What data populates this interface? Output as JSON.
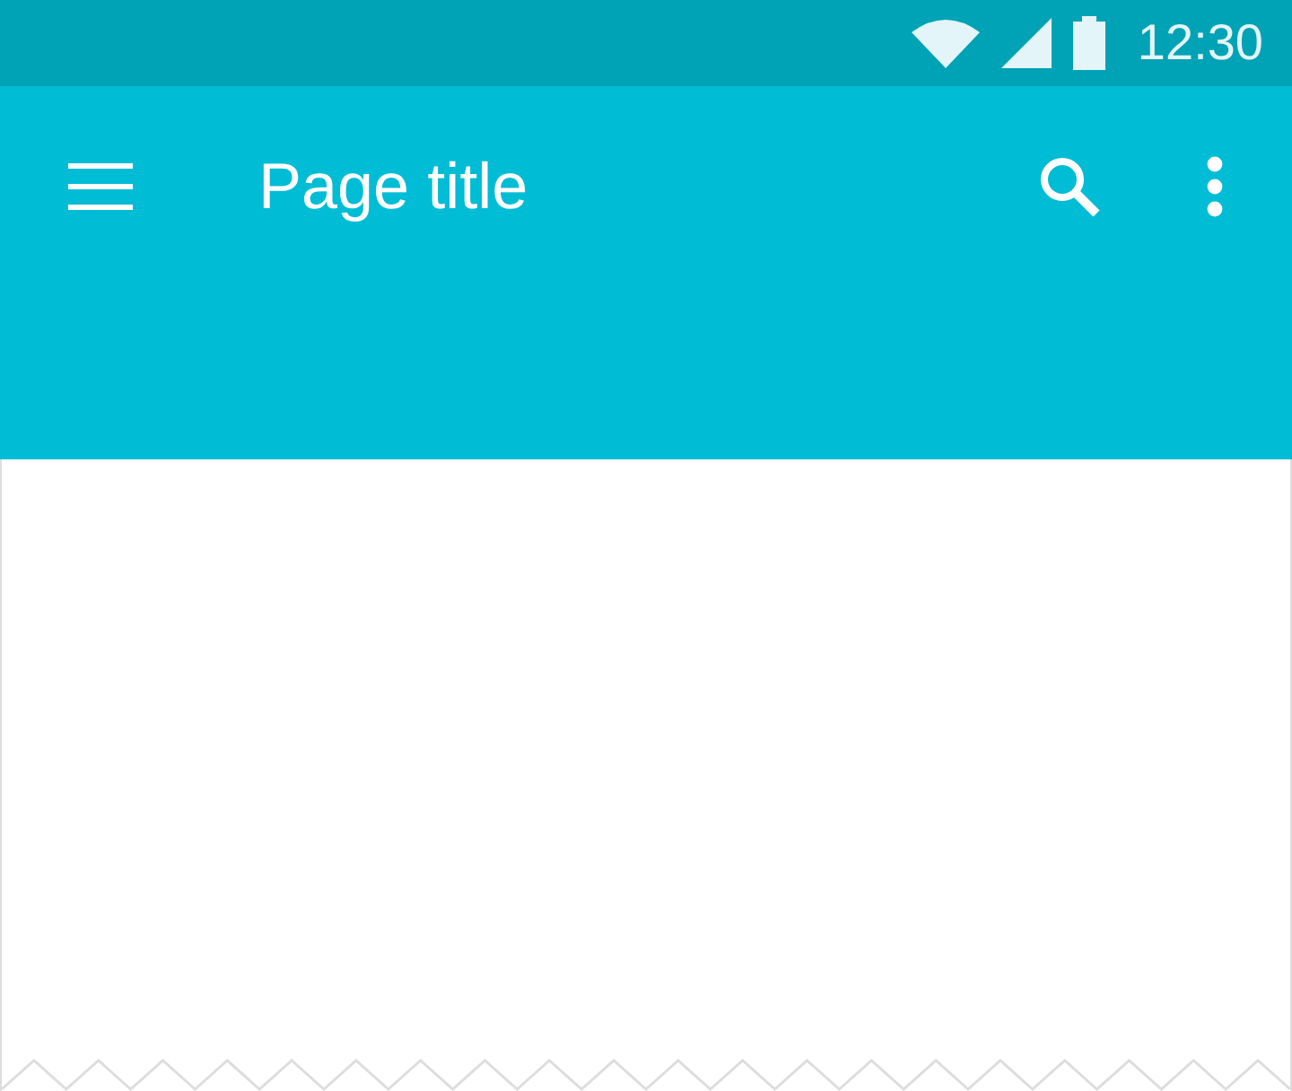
{
  "status_bar": {
    "time": "12:30"
  },
  "app_bar": {
    "title": "Page title"
  }
}
